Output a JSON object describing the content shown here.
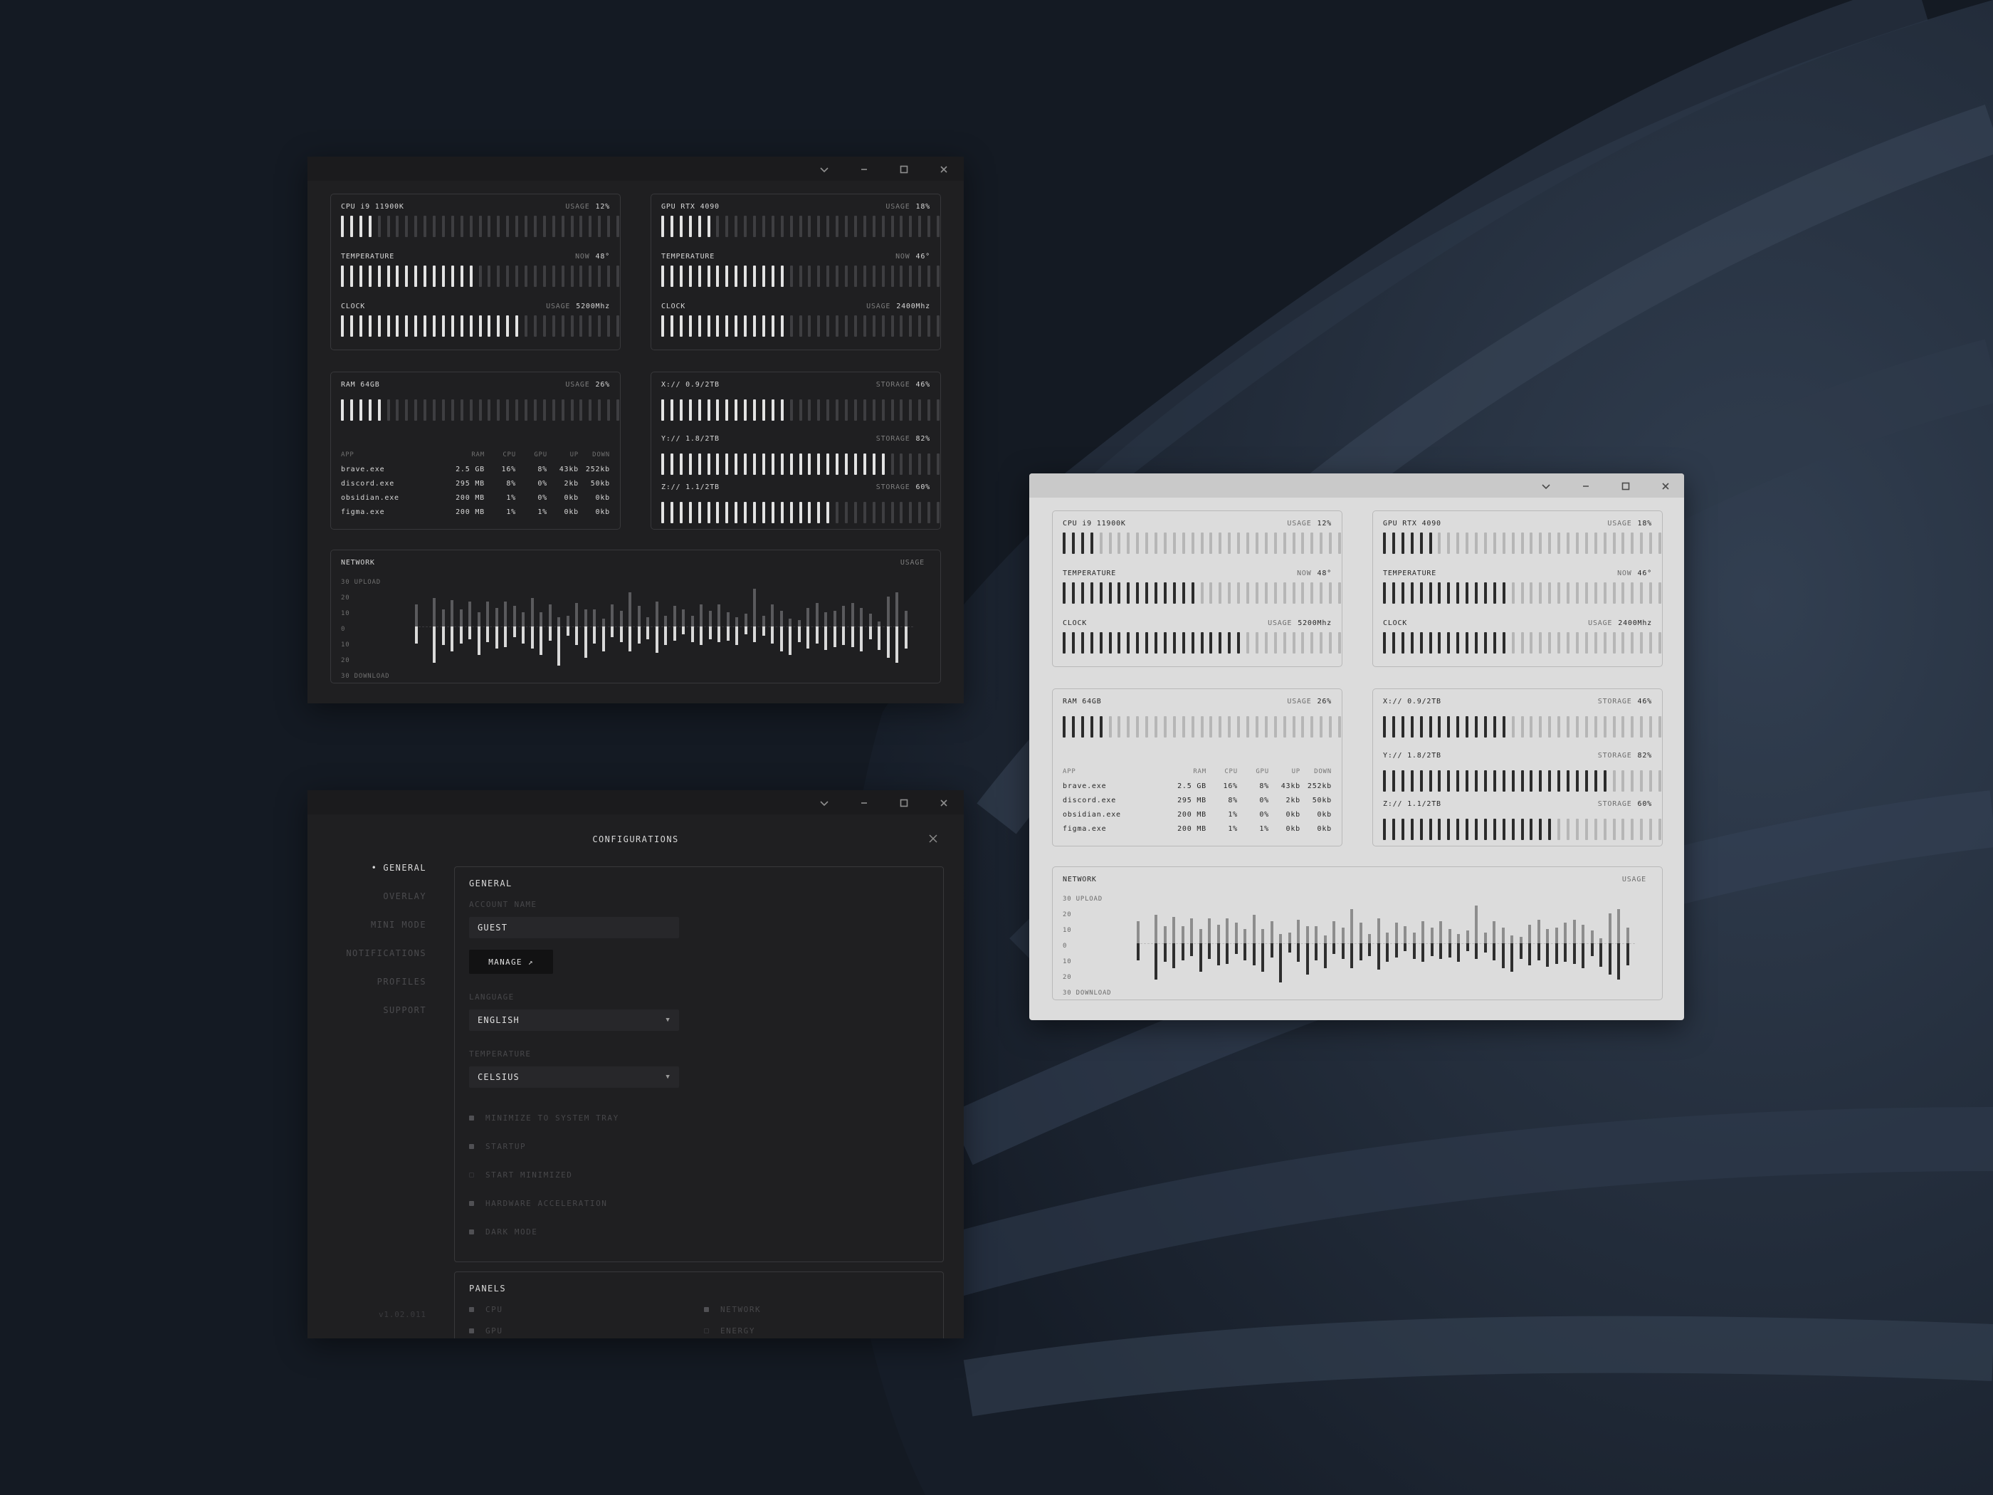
{
  "monitor_window": {
    "cpu": {
      "name": "CPU i9 11900K",
      "usage_key": "USAGE",
      "usage": "12%",
      "usage_level": 0.12,
      "temperature_label": "TEMPERATURE",
      "temperature_key": "NOW",
      "temperature": "48°",
      "temperature_level": 0.48,
      "clock_label": "CLOCK",
      "clock_key": "USAGE",
      "clock": "5200Mhz",
      "clock_level": 0.65
    },
    "gpu": {
      "name": "GPU RTX 4090",
      "usage_key": "USAGE",
      "usage": "18%",
      "usage_level": 0.18,
      "temperature_label": "TEMPERATURE",
      "temperature_key": "NOW",
      "temperature": "46°",
      "temperature_level": 0.46,
      "clock_label": "CLOCK",
      "clock_key": "USAGE",
      "clock": "2400Mhz",
      "clock_level": 0.46
    },
    "ram": {
      "name": "RAM 64GB",
      "usage_key": "USAGE",
      "usage": "26%",
      "usage_level": 0.17
    },
    "apps": {
      "headers": [
        "APP",
        "RAM",
        "CPU",
        "GPU",
        "UP",
        "DOWN"
      ],
      "rows": [
        [
          "brave.exe",
          "2.5 GB",
          "16%",
          "8%",
          "43kb",
          "252kb"
        ],
        [
          "discord.exe",
          "295 MB",
          "8%",
          "0%",
          "2kb",
          "50kb"
        ],
        [
          "obsidian.exe",
          "200 MB",
          "1%",
          "0%",
          "0kb",
          "0kb"
        ],
        [
          "figma.exe",
          "200 MB",
          "1%",
          "1%",
          "0kb",
          "0kb"
        ]
      ]
    },
    "storage": [
      {
        "name": "X:// 0.9/2TB",
        "key": "STORAGE",
        "value": "46%",
        "level": 0.46
      },
      {
        "name": "Y:// 1.8/2TB",
        "key": "STORAGE",
        "value": "82%",
        "level": 0.82
      },
      {
        "name": "Z:// 1.1/2TB",
        "key": "STORAGE",
        "value": "60%",
        "level": 0.6
      }
    ],
    "network": {
      "title": "NETWORK",
      "key": "USAGE",
      "axis": [
        "30  UPLOAD",
        "20",
        "10",
        "0",
        "10",
        "20",
        "30  DOWNLOAD"
      ],
      "upload": [
        14,
        0,
        18,
        11,
        17,
        11,
        16,
        9,
        16,
        12,
        16,
        13,
        9,
        18,
        9,
        14,
        6,
        7,
        15,
        11,
        11,
        5,
        14,
        10,
        22,
        13,
        6,
        16,
        7,
        13,
        11,
        7,
        14,
        10,
        14,
        9,
        6,
        8,
        24,
        7,
        14,
        10,
        5,
        4,
        12,
        15,
        9,
        10,
        13,
        15,
        12,
        8,
        3,
        19,
        22,
        10
      ],
      "download": [
        11,
        0,
        23,
        12,
        16,
        11,
        8,
        18,
        10,
        14,
        13,
        7,
        11,
        14,
        18,
        9,
        25,
        6,
        12,
        20,
        11,
        16,
        7,
        10,
        16,
        11,
        8,
        17,
        12,
        9,
        5,
        10,
        12,
        8,
        10,
        9,
        12,
        5,
        10,
        6,
        11,
        16,
        18,
        10,
        14,
        11,
        15,
        13,
        12,
        13,
        16,
        8,
        15,
        20,
        23,
        14
      ]
    }
  },
  "config_window": {
    "title": "CONFIGURATIONS",
    "nav": [
      "GENERAL",
      "OVERLAY",
      "MINI MODE",
      "NOTIFICATIONS",
      "PROFILES",
      "SUPPORT"
    ],
    "version": "v1.02.011",
    "general": {
      "heading": "GENERAL",
      "account_label": "ACCOUNT NAME",
      "account_value": "GUEST",
      "manage_label": "MANAGE ↗",
      "language_label": "LANGUAGE",
      "language_value": "ENGLISH",
      "temperature_label": "TEMPERATURE",
      "temperature_value": "CELSIUS",
      "options": [
        {
          "label": "MINIMIZE TO SYSTEM TRAY",
          "checked": true
        },
        {
          "label": "STARTUP",
          "checked": true
        },
        {
          "label": "START MINIMIZED",
          "checked": false
        },
        {
          "label": "HARDWARE ACCELERATION",
          "checked": true
        },
        {
          "label": "DARK MODE",
          "checked": true
        }
      ]
    },
    "panels": {
      "heading": "PANELS",
      "items": [
        {
          "label": "CPU",
          "checked": true
        },
        {
          "label": "NETWORK",
          "checked": true
        },
        {
          "label": "GPU",
          "checked": true
        },
        {
          "label": "ENERGY",
          "checked": false
        }
      ]
    }
  },
  "colors": {
    "dark_bg": "#1f1f21",
    "light_bg": "#dcdcdc",
    "desktop": "#141a23"
  }
}
